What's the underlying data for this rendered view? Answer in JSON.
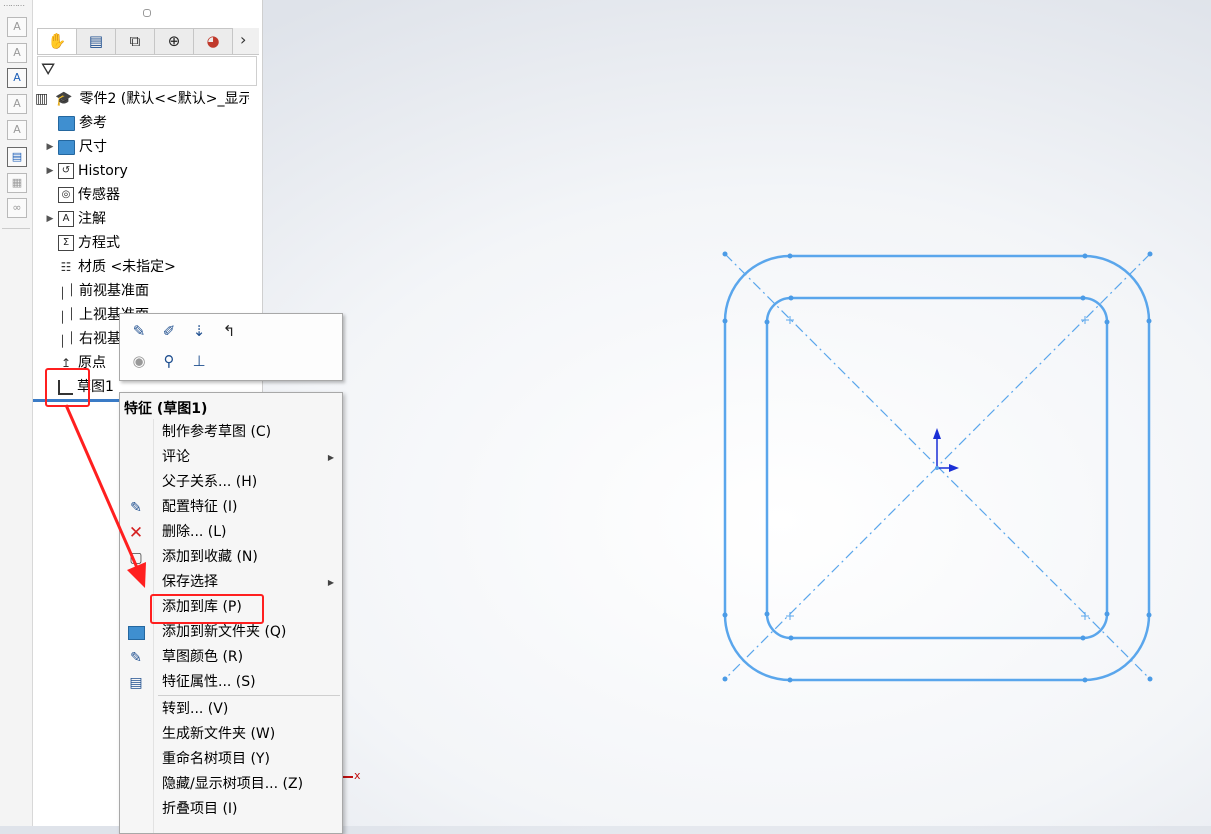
{
  "colors": {
    "sketch": "#5aa6ec",
    "sketch_dark": "#4b9be6",
    "annotation": "#ff1f1f",
    "selection": "#3a7bc6",
    "origin_blue": "#1a2fd6"
  },
  "toolstrip": {
    "icons": [
      "text-icon",
      "text-edit-icon",
      "text-add-icon",
      "text-link-icon",
      "text-style-icon",
      "print-icon",
      "pattern-icon",
      "link-icon"
    ]
  },
  "tabs": [
    "feature-manager",
    "property-manager",
    "configuration-manager",
    "dimxpert-manager",
    "display-manager"
  ],
  "tree": {
    "root_label": "零件2  (默认<<默认>_显示",
    "items": [
      {
        "label": "参考",
        "icon": "folder-icon",
        "expandable": false
      },
      {
        "label": "尺寸",
        "icon": "folder-icon",
        "expandable": true
      },
      {
        "label": "History",
        "icon": "history-icon",
        "expandable": true
      },
      {
        "label": "传感器",
        "icon": "sensor-icon",
        "expandable": false
      },
      {
        "label": "注解",
        "icon": "annotation-icon",
        "expandable": true
      },
      {
        "label": "方程式",
        "icon": "equation-icon",
        "expandable": false
      },
      {
        "label": "材质 <未指定>",
        "icon": "material-icon",
        "expandable": false
      },
      {
        "label": "前视基准面",
        "icon": "plane-icon",
        "expandable": false
      },
      {
        "label": "上视基准面",
        "icon": "plane-icon",
        "expandable": false
      },
      {
        "label": "右视基准面",
        "icon": "plane-icon",
        "expandable": false
      },
      {
        "label": "原点",
        "icon": "origin-icon",
        "expandable": false
      },
      {
        "label": "草图1",
        "icon": "sketch-icon",
        "expandable": false,
        "selected": true
      }
    ]
  },
  "context_toolbar": {
    "row1": [
      "edit-sketch-icon",
      "edit-feature-icon",
      "rollback-icon",
      "undo-arrow-icon"
    ],
    "row2": [
      "hide-icon",
      "zoom-to-selection-icon",
      "normal-to-icon"
    ]
  },
  "context_menu": {
    "header": "特征 (草图1)",
    "items": [
      {
        "label": "制作参考草图 (C)",
        "icon": "",
        "submenu": false
      },
      {
        "label": "评论",
        "icon": "",
        "submenu": true
      },
      {
        "label": "父子关系... (H)",
        "icon": "",
        "submenu": false
      },
      {
        "label": "配置特征 (I)",
        "icon": "configure-icon",
        "submenu": false
      },
      {
        "label": "删除... (L)",
        "icon": "delete-icon",
        "submenu": false
      },
      {
        "label": "添加到收藏 (N)",
        "icon": "favorite-icon",
        "submenu": false
      },
      {
        "label": "保存选择",
        "icon": "",
        "submenu": true
      },
      {
        "label": "添加到库 (P)",
        "icon": "",
        "submenu": false,
        "highlighted": true
      },
      {
        "label": "添加到新文件夹 (Q)",
        "icon": "folder-icon",
        "submenu": false
      },
      {
        "label": "草图颜色 (R)",
        "icon": "color-icon",
        "submenu": false
      },
      {
        "label": "特征属性... (S)",
        "icon": "properties-icon",
        "submenu": false
      },
      {
        "label": "转到... (V)",
        "icon": "",
        "submenu": false
      },
      {
        "label": "生成新文件夹 (W)",
        "icon": "",
        "submenu": false
      },
      {
        "label": "重命名树项目 (Y)",
        "icon": "",
        "submenu": false
      },
      {
        "label": "隐藏/显示树项目... (Z)",
        "icon": "",
        "submenu": false
      },
      {
        "label": "折叠项目 (I)",
        "icon": "",
        "submenu": false
      }
    ]
  },
  "origin_label": "x"
}
